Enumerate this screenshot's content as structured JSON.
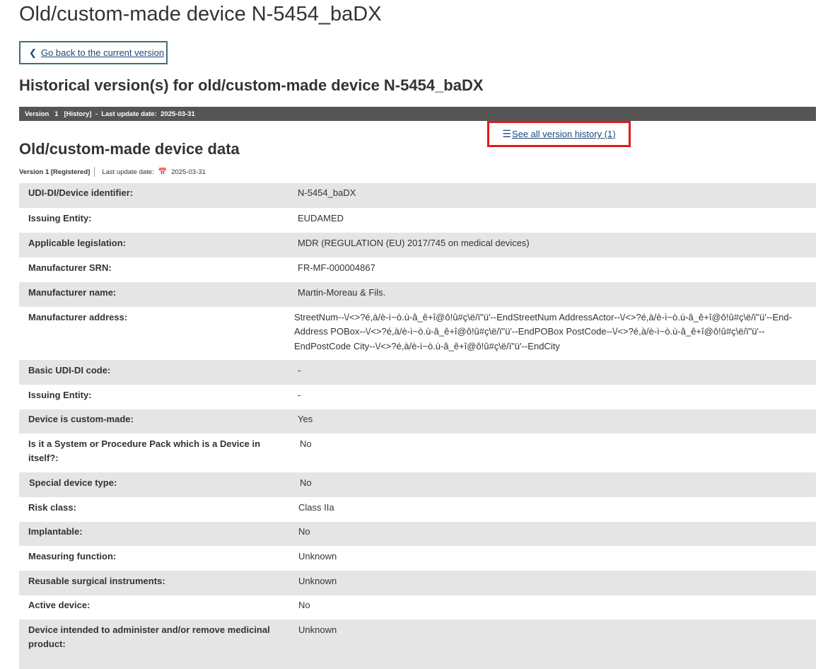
{
  "page": {
    "title": "Old/custom-made device N-5454_baDX",
    "back_label": "Go back to the current version",
    "history_title": "Historical version(s) for old/custom-made device N-5454_baDX"
  },
  "version_bar": {
    "text": "Version   1   [History]  -  Last update date:  2025-03-31"
  },
  "history_link": {
    "label": "See all version history (1)"
  },
  "section": {
    "title": "Old/custom-made device data",
    "version": "Version 1  [Registered]",
    "last_update_label": "Last update date:",
    "last_update_value": "2025-03-31"
  },
  "rows": [
    {
      "label": "UDI-DI/Device identifier:",
      "value": "N-5454_baDX"
    },
    {
      "label": "Issuing Entity:",
      "value": "EUDAMED"
    },
    {
      "label": "Applicable legislation:",
      "value": "MDR (REGULATION (EU) 2017/745 on medical devices)"
    },
    {
      "label": "Manufacturer SRN:",
      "value": "FR-MF-000004867"
    },
    {
      "label": "Manufacturer name:",
      "value": "Martin-Moreau & Fils."
    },
    {
      "label": "Manufacturer address:",
      "value": " StreetNum--\\/<>?é,à/è-ì~ò.ù-â_ê+î@ô!û#ç\\ë/ï\"ü'--EndStreetNum AddressActor--\\/<>?é,à/è-ì~ò.ù-â_ê+î@ô!û#ç\\ë/ï\"ü'--End-Address POBox--\\/<>?é,à/è-ì~ò.ù-â_ê+î@ô!û#ç\\ë/ï\"ü'--EndPOBox PostCode--\\/<>?é,à/è-ì~ò.ù-â_ê+î@ô!û#ç\\ë/ï\"ü'--EndPostCode City--\\/<>?é,à/è-ì~ò.ù-â_ê+î@ô!û#ç\\ë/ï\"ü'--EndCity"
    },
    {
      "label": "Basic UDI-DI code:",
      "value": "-"
    },
    {
      "label": "Issuing Entity:",
      "value": "-"
    },
    {
      "label": "Device is custom-made:",
      "value": "Yes"
    },
    {
      "label": "Is it a System or Procedure Pack which is a Device in itself?:",
      "value": "No"
    },
    {
      "label": "Special device type:",
      "value": "No"
    },
    {
      "label": "Risk class:",
      "value": "Class IIa"
    },
    {
      "label": "Implantable:",
      "value": "No"
    },
    {
      "label": "Measuring function:",
      "value": "Unknown"
    },
    {
      "label": "Reusable surgical instruments:",
      "value": "Unknown"
    },
    {
      "label": "Active device:",
      "value": "No"
    },
    {
      "label": "Device intended to administer and/or remove medicinal product:",
      "value": "Unknown"
    }
  ]
}
